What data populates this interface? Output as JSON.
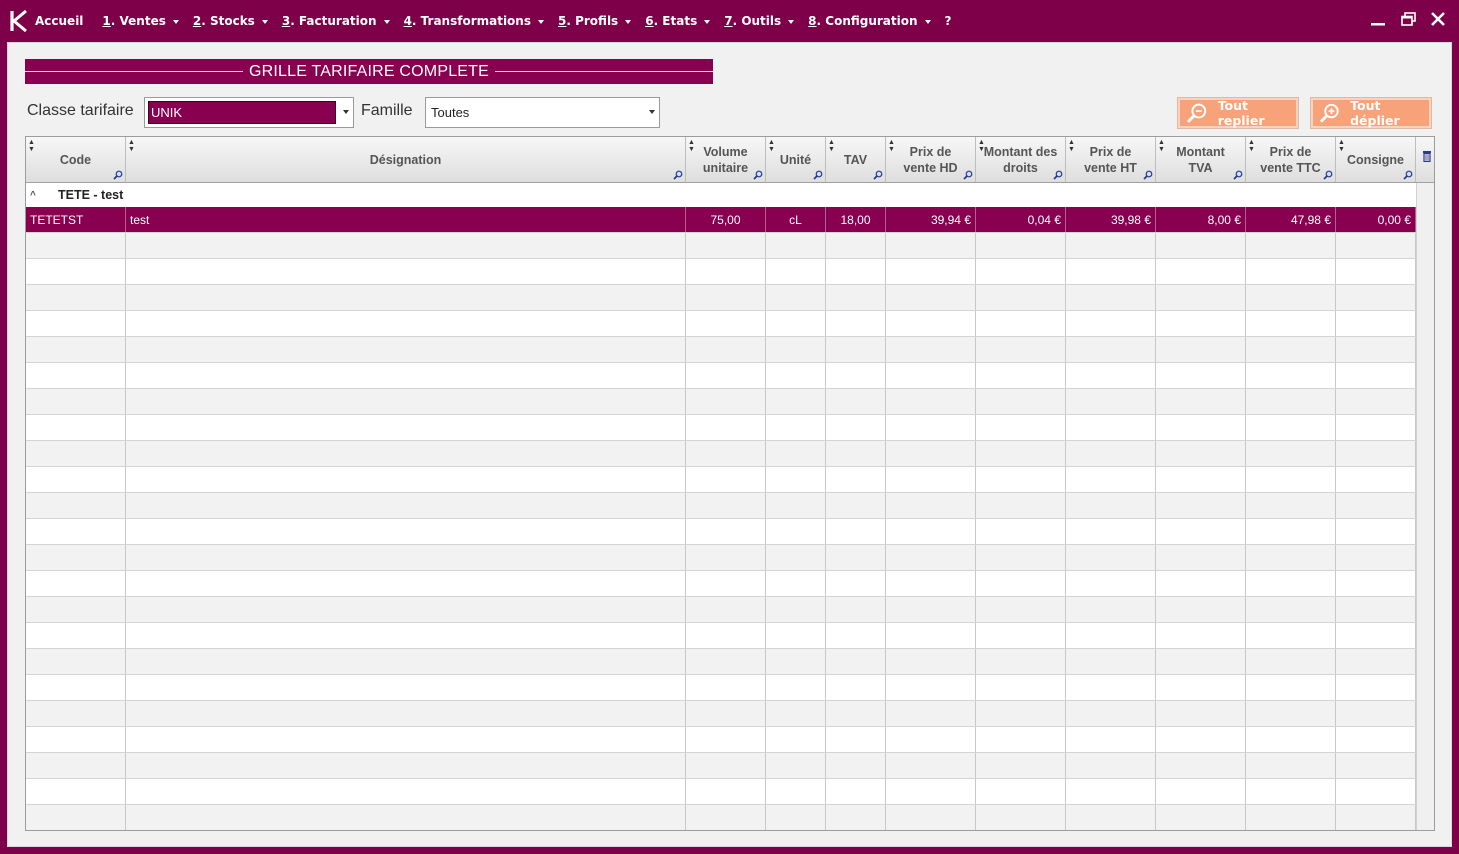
{
  "menubar": {
    "logo_letter": "K",
    "items": [
      {
        "num": "",
        "label": "Accueil",
        "caret": false
      },
      {
        "num": "1",
        "label": ". Ventes",
        "caret": true
      },
      {
        "num": "2",
        "label": ". Stocks",
        "caret": true
      },
      {
        "num": "3",
        "label": ". Facturation",
        "caret": true
      },
      {
        "num": "4",
        "label": ". Transformations",
        "caret": true
      },
      {
        "num": "5",
        "label": ". Profils",
        "caret": true
      },
      {
        "num": "6",
        "label": ". Etats",
        "caret": true
      },
      {
        "num": "7",
        "label": ". Outils",
        "caret": true
      },
      {
        "num": "8",
        "label": ". Configuration",
        "caret": true
      },
      {
        "num": "",
        "label": "?",
        "caret": false
      }
    ]
  },
  "page": {
    "title": "GRILLE TARIFAIRE COMPLETE",
    "classe_label": "Classe tarifaire",
    "classe_value": "UNIK",
    "famille_label": "Famille",
    "famille_value": "Toutes",
    "btn_replier": "Tout replier",
    "btn_deplier": "Tout déplier"
  },
  "grid": {
    "columns": [
      {
        "key": "code",
        "label": "Code"
      },
      {
        "key": "designation",
        "label": "Désignation"
      },
      {
        "key": "volume",
        "label": "Volume unitaire"
      },
      {
        "key": "unite",
        "label": "Unité"
      },
      {
        "key": "tav",
        "label": "TAV"
      },
      {
        "key": "prix_hd",
        "label": "Prix de vente HD"
      },
      {
        "key": "droits",
        "label": "Montant des droits"
      },
      {
        "key": "prix_ht",
        "label": "Prix de vente HT"
      },
      {
        "key": "tva",
        "label": "Montant TVA"
      },
      {
        "key": "prix_ttc",
        "label": "Prix de vente TTC"
      },
      {
        "key": "consigne",
        "label": "Consigne"
      }
    ],
    "group_label": "TETE - test",
    "rows": [
      {
        "code": "TETETST",
        "designation": "test",
        "volume": "75,00",
        "unite": "cL",
        "tav": "18,00",
        "prix_hd": "39,94 €",
        "droits": "0,04 €",
        "prix_ht": "39,98 €",
        "tva": "8,00 €",
        "prix_ttc": "47,98 €",
        "consigne": "0,00 €"
      }
    ]
  },
  "colors": {
    "brand": "#7e0049",
    "selection": "#8a0051",
    "action_button": "#f8a27a"
  }
}
